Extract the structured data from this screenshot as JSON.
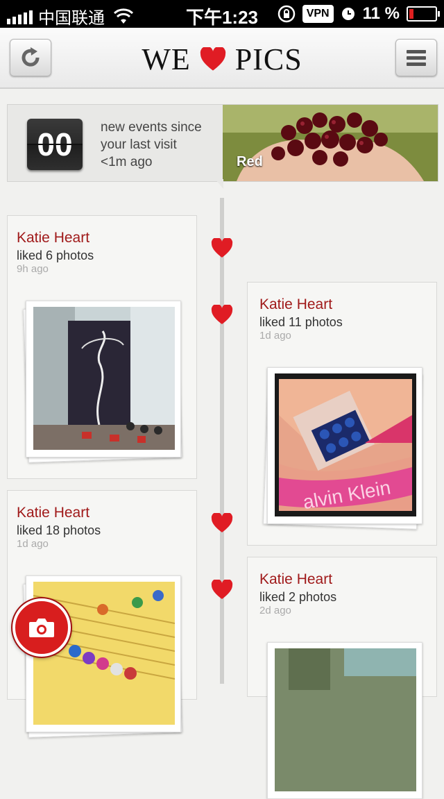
{
  "status": {
    "carrier": "中国联通",
    "time": "下午1:23",
    "vpn": "VPN",
    "battery": "11 %"
  },
  "nav": {
    "logo_left": "WE",
    "logo_right": "PICS"
  },
  "summary": {
    "count": "00",
    "line1": "new events since",
    "line2": "your last visit",
    "line3": "<1m ago",
    "photo_label": "Red"
  },
  "events": [
    {
      "name": "Katie Heart",
      "action": "liked 6 photos",
      "ago": "9h ago"
    },
    {
      "name": "Katie Heart",
      "action": "liked 11 photos",
      "ago": "1d ago"
    },
    {
      "name": "Katie Heart",
      "action": "liked 18 photos",
      "ago": "1d ago"
    },
    {
      "name": "Katie Heart",
      "action": "liked 2 photos",
      "ago": "2d ago"
    }
  ],
  "colors": {
    "accent": "#a01a1a",
    "heart": "#e01c24"
  }
}
